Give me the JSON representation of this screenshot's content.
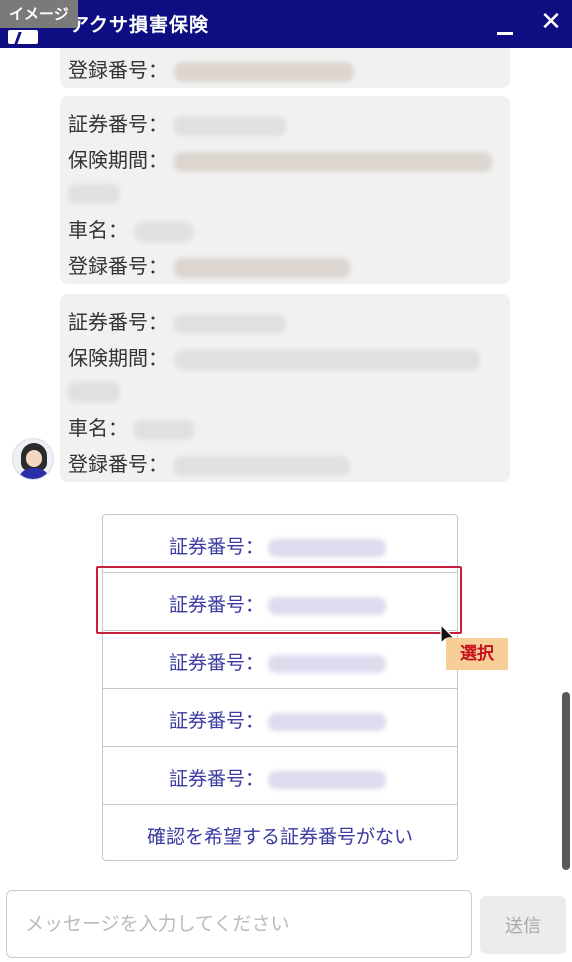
{
  "badge": "イメージ",
  "app_title": "アクサ損害保険",
  "window_controls": {
    "minimize_icon": "minimize-icon",
    "close": "✕"
  },
  "messages": [
    {
      "label_reg": "登録番号："
    },
    {
      "label_policy": "証券番号：",
      "label_period": "保険期間：",
      "label_car": "車名：",
      "label_reg": "登録番号："
    },
    {
      "label_policy": "証券番号：",
      "label_period": "保険期間：",
      "label_car": "車名：",
      "label_reg": "登録番号："
    }
  ],
  "options": [
    {
      "label": "証券番号："
    },
    {
      "label": "証券番号："
    },
    {
      "label": "証券番号："
    },
    {
      "label": "証券番号："
    },
    {
      "label": "証券番号："
    },
    {
      "label": "確認を希望する証券番号がない"
    }
  ],
  "selected_option_index": 1,
  "select_tag": "選択",
  "composer": {
    "placeholder": "メッセージを入力してください",
    "value": "",
    "send_label": "送信"
  },
  "colors": {
    "header": "#0e0e82",
    "option_text": "#3a3aa0",
    "highlight": "#c61e3e",
    "tag_bg": "#f6cf96",
    "tag_text": "#c6101e"
  }
}
